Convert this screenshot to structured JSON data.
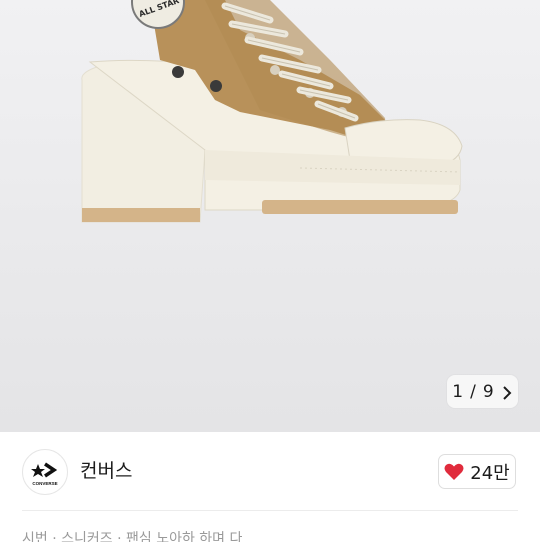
{
  "gallery": {
    "current_page": "1",
    "separator": "/",
    "total_pages": "9",
    "next_icon": "chevron-right-icon",
    "shoe_badge_text": "ALL STAR",
    "colors": {
      "canvas": "#b8915a",
      "sole": "#f2eee2",
      "laces": "#ece8dc"
    }
  },
  "brand": {
    "name": "컨버스",
    "logo_text": "CONVERSE",
    "logo_icon": "converse-star-chevron-icon"
  },
  "like": {
    "count": "24만",
    "icon": "heart-icon",
    "color": "#e02b3c"
  },
  "info": {
    "text": "시번 · 스니커즈 · 팬심 노아하 하며 다"
  }
}
